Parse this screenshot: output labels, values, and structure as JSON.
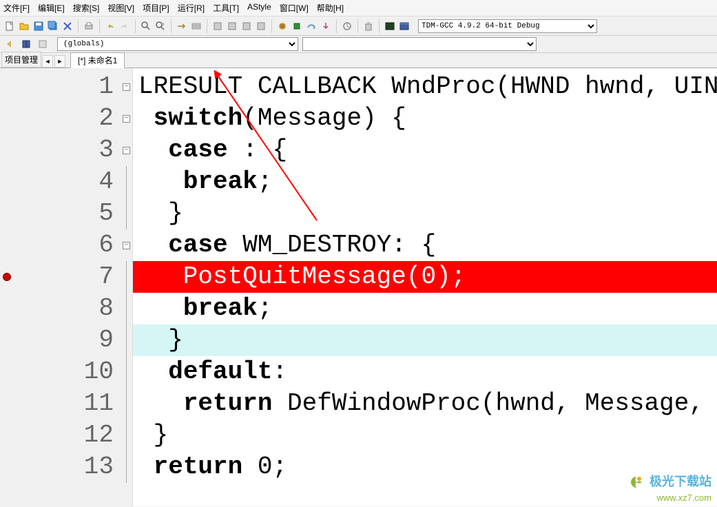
{
  "menu": {
    "file": "文件[F]",
    "edit": "编辑[E]",
    "search": "搜索[S]",
    "view": "视图[V]",
    "project": "项目[P]",
    "run": "运行[R]",
    "tools": "工具[T]",
    "astyle": "AStyle",
    "window": "窗口[W]",
    "help": "帮助[H]"
  },
  "compiler": {
    "selected": "TDM-GCC 4.9.2 64-bit Debug"
  },
  "globals": {
    "selected": "(globals)"
  },
  "sidebar": {
    "label": "项目管理"
  },
  "tab": {
    "filename": "[*] 未命名1"
  },
  "code": {
    "lines": [
      {
        "n": "1",
        "fold": "box",
        "segs": [
          {
            "t": "LRESULT CALLBACK WndProc(HWND hwnd, UIN",
            "c": ""
          }
        ]
      },
      {
        "n": "2",
        "fold": "box",
        "segs": [
          {
            "t": " ",
            "c": ""
          },
          {
            "t": "switch",
            "c": "kw"
          },
          {
            "t": "(Message) {",
            "c": ""
          }
        ]
      },
      {
        "n": "3",
        "fold": "box",
        "segs": [
          {
            "t": "  ",
            "c": ""
          },
          {
            "t": "case",
            "c": "kw"
          },
          {
            "t": " : {",
            "c": ""
          }
        ]
      },
      {
        "n": "4",
        "fold": "line",
        "segs": [
          {
            "t": "   ",
            "c": ""
          },
          {
            "t": "break",
            "c": "kw"
          },
          {
            "t": ";",
            "c": ""
          }
        ]
      },
      {
        "n": "5",
        "fold": "line",
        "segs": [
          {
            "t": "  }",
            "c": ""
          }
        ]
      },
      {
        "n": "6",
        "fold": "box",
        "segs": [
          {
            "t": "  ",
            "c": ""
          },
          {
            "t": "case",
            "c": "kw"
          },
          {
            "t": " WM_DESTROY: {",
            "c": ""
          }
        ]
      },
      {
        "n": "7",
        "fold": "line",
        "hl": "red",
        "bp": true,
        "segs": [
          {
            "t": "   PostQuitMessage(0);",
            "c": ""
          }
        ]
      },
      {
        "n": "8",
        "fold": "line",
        "segs": [
          {
            "t": "   ",
            "c": ""
          },
          {
            "t": "break",
            "c": "kw"
          },
          {
            "t": ";",
            "c": ""
          }
        ]
      },
      {
        "n": "9",
        "fold": "line",
        "hl": "cyan",
        "segs": [
          {
            "t": "  }",
            "c": ""
          }
        ]
      },
      {
        "n": "10",
        "fold": "line",
        "segs": [
          {
            "t": "  ",
            "c": ""
          },
          {
            "t": "default",
            "c": "kw"
          },
          {
            "t": ":",
            "c": ""
          }
        ]
      },
      {
        "n": "11",
        "fold": "line",
        "segs": [
          {
            "t": "   ",
            "c": ""
          },
          {
            "t": "return",
            "c": "kw"
          },
          {
            "t": " DefWindowProc(hwnd, Message,",
            "c": ""
          }
        ]
      },
      {
        "n": "12",
        "fold": "line",
        "segs": [
          {
            "t": " }",
            "c": ""
          }
        ]
      },
      {
        "n": "13",
        "fold": "line",
        "segs": [
          {
            "t": " ",
            "c": ""
          },
          {
            "t": "return",
            "c": "kw"
          },
          {
            "t": " 0;",
            "c": ""
          }
        ]
      }
    ]
  },
  "watermark": {
    "name": "极光下载站",
    "url": "www.xz7.com"
  }
}
